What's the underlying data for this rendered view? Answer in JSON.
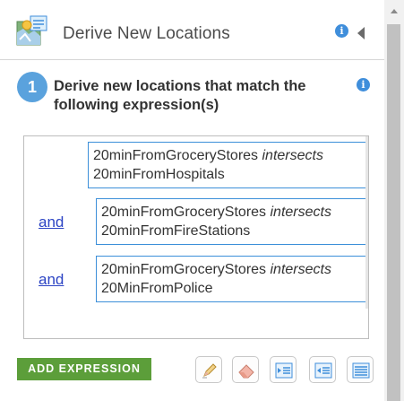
{
  "header": {
    "title": "Derive New Locations",
    "tool_icon": "derive-new-locations-icon",
    "info_icon": "info-icon",
    "collapse_icon": "collapse-left-icon"
  },
  "step": {
    "number": "1",
    "text": "Derive new locations that match the following expression(s)"
  },
  "expressions": [
    {
      "connector": "",
      "left": "20minFromGroceryStores",
      "operator": "intersects",
      "right": "20minFromHospitals"
    },
    {
      "connector": "and",
      "left": "20minFromGroceryStores",
      "operator": "intersects",
      "right": "20minFromFireStations"
    },
    {
      "connector": "and",
      "left": "20minFromGroceryStores",
      "operator": "intersects",
      "right": "20MinFromPolice"
    }
  ],
  "toolbar": {
    "add_expression_label": "ADD EXPRESSION",
    "buttons": [
      "edit-pencil-icon",
      "eraser-icon",
      "indent-expression-icon",
      "outdent-expression-icon",
      "clear-all-icon"
    ]
  },
  "colors": {
    "accent_blue": "#3f8edb",
    "step_badge": "#5aa2dd",
    "expression_border": "#3c8fd9",
    "add_button": "#5c9e3a",
    "link": "#2c44c4"
  }
}
